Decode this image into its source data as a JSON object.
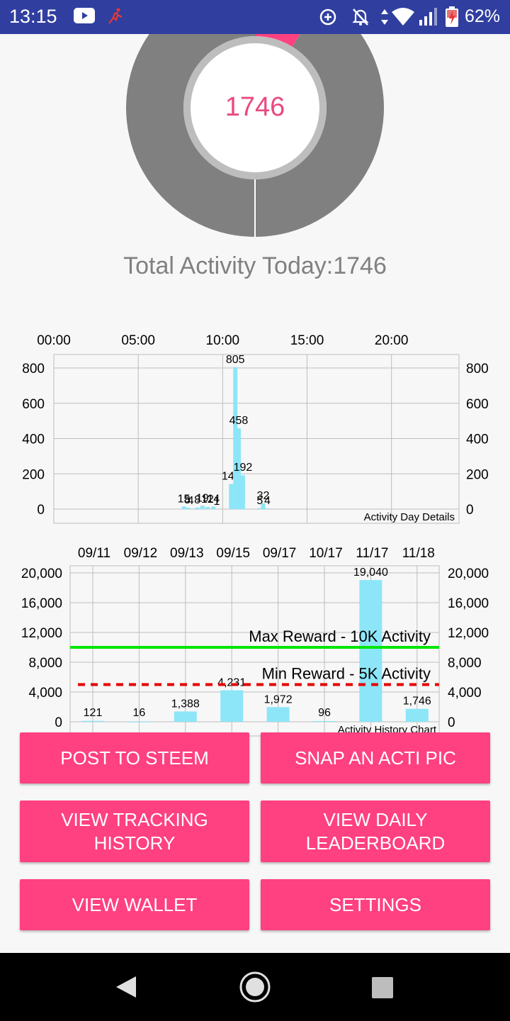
{
  "status_bar": {
    "time": "13:15",
    "battery_percent": "62%",
    "icons": [
      "youtube-icon",
      "running-app-icon",
      "data-saver-icon",
      "notifications-off-icon",
      "data-transfer-icon",
      "wifi-icon",
      "signal-icon",
      "battery-charging-icon"
    ]
  },
  "ring": {
    "value": "1746",
    "accent_color": "#ff4081",
    "fill_color": "#808080",
    "progress_fraction": 0.0873
  },
  "total_activity": {
    "text": "Total Activity Today:1746"
  },
  "chart_data": [
    {
      "type": "bar",
      "description": "Activity Day Details",
      "x_tick_labels": [
        "00:00",
        "05:00",
        "10:00",
        "15:00",
        "20:00"
      ],
      "x_range_hours": [
        0,
        24
      ],
      "y_tick_labels": [
        "0",
        "200",
        "400",
        "600",
        "800"
      ],
      "ylim": [
        0,
        880
      ],
      "grid": true,
      "bar_color": "#8ce6f8",
      "bars": [
        {
          "hour": 7.7,
          "value": 15,
          "label": "15"
        },
        {
          "hour": 7.9,
          "value": 8,
          "label": "8"
        },
        {
          "hour": 8.1,
          "value": 4,
          "label": "4"
        },
        {
          "hour": 8.5,
          "value": 8,
          "label": "8"
        },
        {
          "hour": 8.8,
          "value": 19,
          "label": "19"
        },
        {
          "hour": 9.1,
          "value": 12,
          "label": "12"
        },
        {
          "hour": 9.45,
          "value": 14,
          "label": "14"
        },
        {
          "hour": 9.65,
          "value": 1,
          "label": "1"
        },
        {
          "hour": 10.5,
          "value": 142,
          "label": "142"
        },
        {
          "hour": 10.75,
          "value": 805,
          "label": "805"
        },
        {
          "hour": 10.95,
          "value": 458,
          "label": "458"
        },
        {
          "hour": 11.2,
          "value": 192,
          "label": "192"
        },
        {
          "hour": 12.2,
          "value": 5,
          "label": "5"
        },
        {
          "hour": 12.4,
          "value": 32,
          "label": "32"
        },
        {
          "hour": 12.65,
          "value": 4,
          "label": "4"
        }
      ]
    },
    {
      "type": "bar",
      "description": "Activity History Chart",
      "categories": [
        "09/11",
        "09/12",
        "09/13",
        "09/15",
        "09/17",
        "10/17",
        "11/17",
        "11/18"
      ],
      "values": [
        121,
        16,
        1388,
        4231,
        1972,
        96,
        19040,
        1746
      ],
      "value_labels": [
        "121",
        "16",
        "1,388",
        "4,231",
        "1,972",
        "96",
        "19,040",
        "1,746"
      ],
      "y_tick_labels": [
        "0",
        "4,000",
        "8,000",
        "12,000",
        "16,000",
        "20,000"
      ],
      "ylim": [
        0,
        20000
      ],
      "grid": true,
      "bar_color": "#8ce6f8",
      "reference_lines": [
        {
          "label": "Max Reward - 10K Activity",
          "value": 10000,
          "color": "#00e600",
          "style": "solid"
        },
        {
          "label": "Min Reward - 5K Activity",
          "value": 5000,
          "color": "#e60000",
          "style": "dashed"
        }
      ]
    }
  ],
  "buttons": {
    "post_to_steem": "POST TO STEEM",
    "snap_pic": "SNAP AN ACTI PIC",
    "view_tracking_history": "VIEW TRACKING HISTORY",
    "view_daily_leaderboard": "VIEW DAILY LEADERBOARD",
    "view_wallet": "VIEW WALLET",
    "settings": "SETTINGS"
  },
  "nav_bar": {
    "icons": [
      "back-icon",
      "home-icon",
      "recents-icon"
    ]
  }
}
